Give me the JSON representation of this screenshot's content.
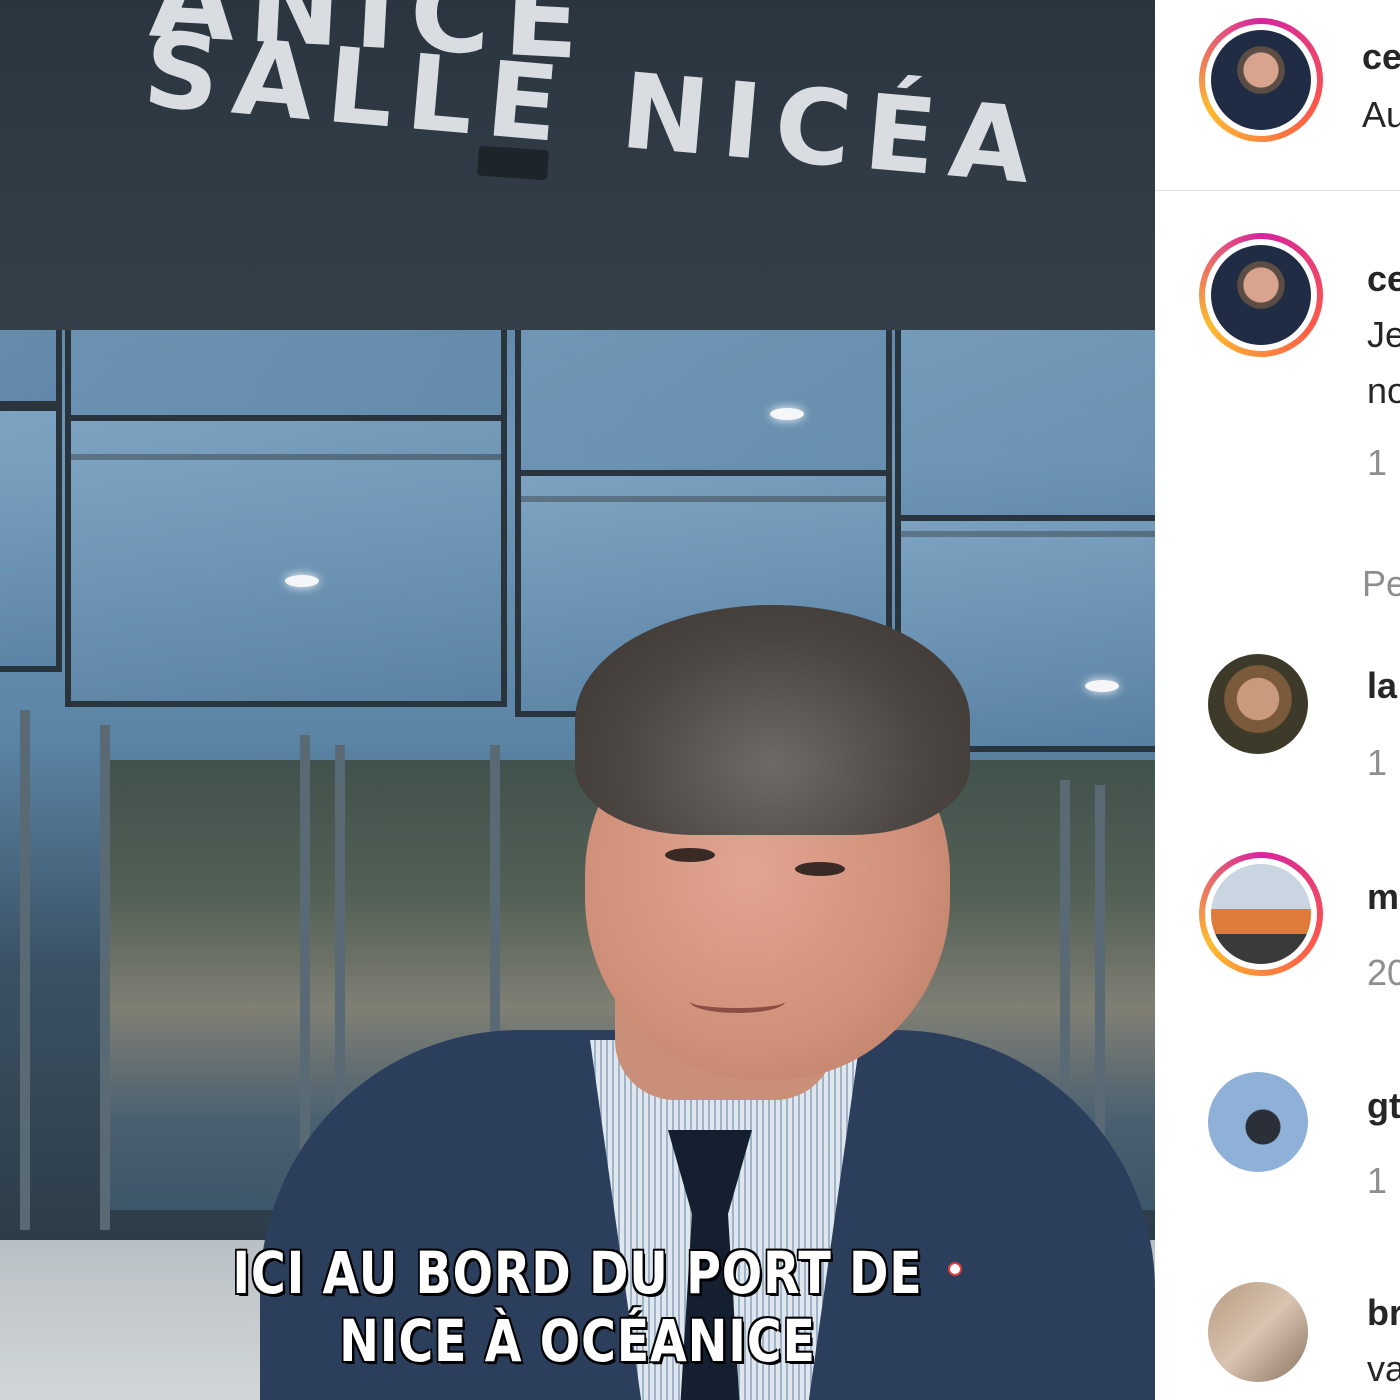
{
  "video": {
    "sign_line1": "ANICE",
    "sign_line2": "SALLE NICÉA",
    "caption_line1": "ICI AU BORD DU PORT DE",
    "caption_line2": "NICE À OCÉANICE"
  },
  "post_header": {
    "username": "ce",
    "subtitle": "Au"
  },
  "caption_post": {
    "username": "ce",
    "text_line1": "Je",
    "text_line2": "no",
    "timestamp": "1"
  },
  "section_label": "Pe",
  "comments": [
    {
      "username": "la",
      "meta": "1",
      "avatar": "girl-photo"
    },
    {
      "username": "m",
      "meta": "20",
      "avatar": "group-photo"
    },
    {
      "username": "gt",
      "meta": "1",
      "avatar": "sunglasses-photo"
    },
    {
      "username": "br",
      "meta": "va",
      "avatar": "street-photo"
    }
  ],
  "colors": {
    "story_ring_start": "#d6249f",
    "story_ring_mid": "#fd5949",
    "story_ring_end": "#fdbb2d",
    "text_primary": "#262626",
    "text_secondary": "#8e8e8e"
  }
}
